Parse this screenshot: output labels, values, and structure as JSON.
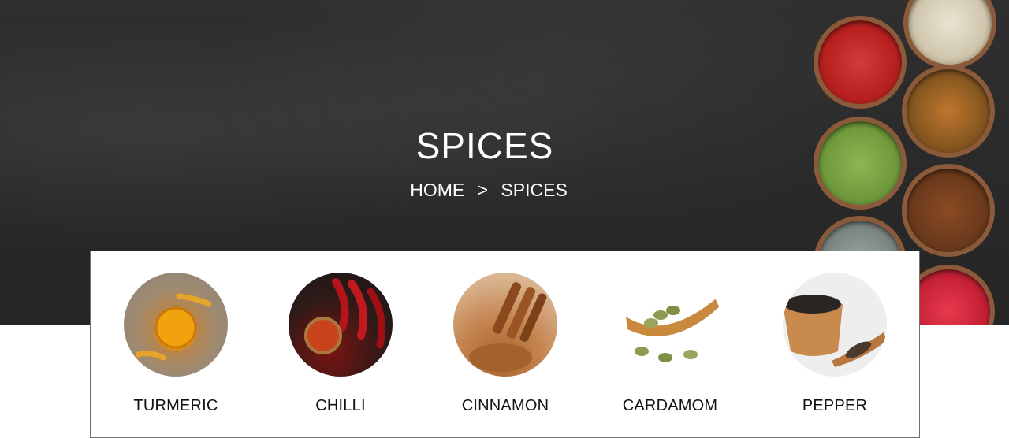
{
  "hero": {
    "title": "SPICES",
    "breadcrumb": {
      "home": "HOME",
      "separator": ">",
      "current": "SPICES"
    }
  },
  "spices": [
    {
      "label": "TURMERIC",
      "icon": "turmeric-image"
    },
    {
      "label": "CHILLI",
      "icon": "chilli-image"
    },
    {
      "label": "CINNAMON",
      "icon": "cinnamon-image"
    },
    {
      "label": "CARDAMOM",
      "icon": "cardamom-image"
    },
    {
      "label": "PEPPER",
      "icon": "pepper-image"
    }
  ],
  "colors": {
    "hero_background": "#2b2b2b",
    "text_light": "#ffffff",
    "text_dark": "#111111",
    "card_border": "#6f6f6f"
  }
}
